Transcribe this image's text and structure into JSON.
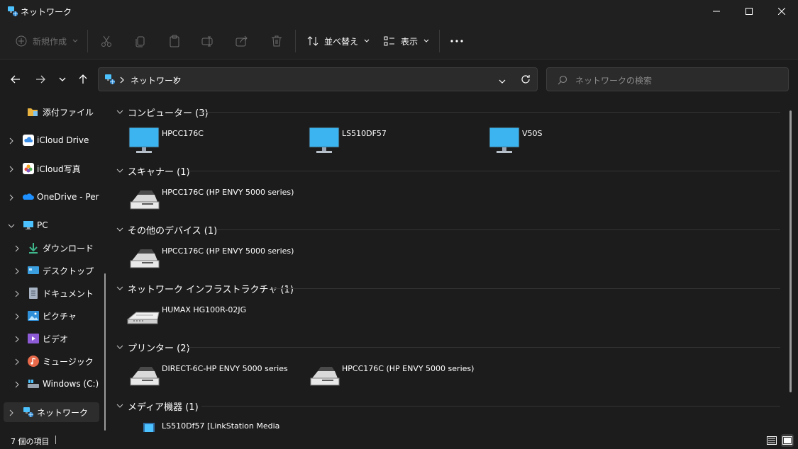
{
  "window": {
    "title": "ネットワーク"
  },
  "toolbar": {
    "new_label": "新規作成",
    "sort_label": "並べ替え",
    "view_label": "表示"
  },
  "address": {
    "crumbs": [
      "ネットワーク"
    ]
  },
  "search": {
    "placeholder": "ネットワークの検索"
  },
  "sidebar": {
    "items": [
      {
        "label": "添付ファイル"
      },
      {
        "label": "iCloud Drive"
      },
      {
        "label": "iCloud写真"
      },
      {
        "label": "OneDrive - Perso"
      },
      {
        "label": "PC"
      },
      {
        "label": "ダウンロード"
      },
      {
        "label": "デスクトップ"
      },
      {
        "label": "ドキュメント"
      },
      {
        "label": "ピクチャ"
      },
      {
        "label": "ビデオ"
      },
      {
        "label": "ミュージック"
      },
      {
        "label": "Windows (C:)"
      },
      {
        "label": "ネットワーク"
      }
    ]
  },
  "groups": [
    {
      "title": "コンピューター (3)",
      "items": [
        "HPCC176C",
        "LS510DF57",
        "V50S"
      ]
    },
    {
      "title": "スキャナー (1)",
      "items": [
        "HPCC176C (HP ENVY 5000 series)"
      ]
    },
    {
      "title": "その他のデバイス (1)",
      "items": [
        "HPCC176C (HP ENVY 5000 series)"
      ]
    },
    {
      "title": "ネットワーク インフラストラクチャ (1)",
      "items": [
        "HUMAX HG100R-02JG"
      ]
    },
    {
      "title": "プリンター (2)",
      "items": [
        "DIRECT-6C-HP ENVY 5000 series",
        "HPCC176C (HP ENVY 5000 series)"
      ]
    },
    {
      "title": "メディア機器 (1)",
      "items": [
        "LS510Df57 [LinkStation Media"
      ]
    }
  ],
  "status": {
    "count": "7 個の項目"
  },
  "colors": {
    "background": "#1c1c1c",
    "toolbar": "#202020",
    "monitor_blue": "#4cc2ff"
  }
}
